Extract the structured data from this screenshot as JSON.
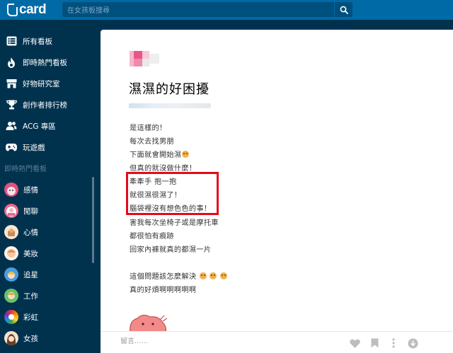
{
  "header": {
    "logo_text": "card",
    "search_placeholder": "在女孩板搜尋"
  },
  "sidebar": {
    "nav": [
      {
        "label": "所有看板",
        "icon": "list-icon"
      },
      {
        "label": "即時熱門看板",
        "icon": "flame-icon"
      },
      {
        "label": "好物研究室",
        "icon": "store-icon"
      },
      {
        "label": "創作者排行榜",
        "icon": "trophy-icon"
      },
      {
        "label": "ACG 專區",
        "icon": "users-icon"
      },
      {
        "label": "玩遊戲",
        "icon": "gamepad-icon"
      }
    ],
    "section_title": "即時熱門看板",
    "boards": [
      {
        "label": "感情",
        "color": "#e2527f"
      },
      {
        "label": "閒聊",
        "color": "#e86b8e"
      },
      {
        "label": "心情",
        "color": "#f2a66a"
      },
      {
        "label": "美妝",
        "color": "#f7c7d3"
      },
      {
        "label": "追星",
        "color": "#4e9be0"
      },
      {
        "label": "工作",
        "color": "#6cc06a"
      },
      {
        "label": "彩虹",
        "color": "#c65bd6"
      },
      {
        "label": "女孩",
        "color": "#b8774e"
      }
    ]
  },
  "post": {
    "title": "濕濕的好困擾",
    "lines": [
      "是這樣的！",
      "每次去找男朋",
      "下面就會開始濕",
      "但真的就沒做什麼！",
      "牽牽手 抱一抱",
      "就很濕很濕了！",
      "腦袋裡沒有想色色的事！",
      "害我每次坐椅子或是摩托車",
      "都很怕有痕跡",
      "回家內褲就真的都濕一片",
      "",
      "這個問題該怎麼解決",
      "真的好煩啊啊啊啊啊"
    ]
  },
  "footer": {
    "comment_placeholder": "留言......"
  },
  "colors": {
    "topbar": "#006aa6",
    "sidebar": "#00324e",
    "highlight_box": "#e30b18"
  }
}
